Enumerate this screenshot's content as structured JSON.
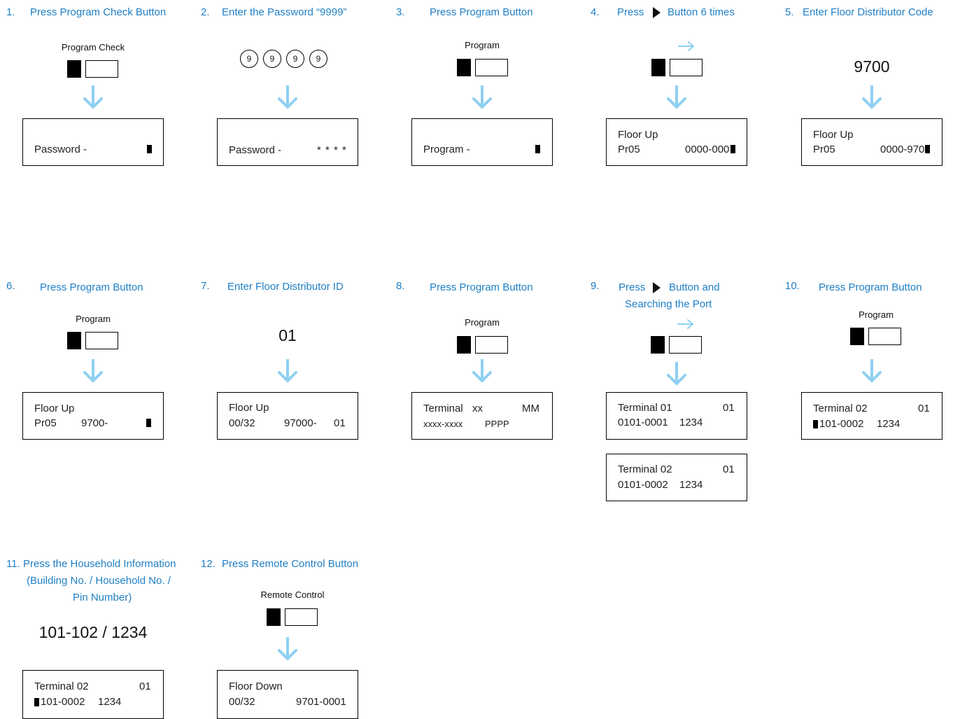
{
  "steps": {
    "s1": {
      "num": "1.",
      "title": "Press Program Check Button",
      "button": "Program Check",
      "lcd": [
        "Password  -",
        ""
      ]
    },
    "s2": {
      "num": "2.",
      "title": "Enter the Password “9999”",
      "digits": [
        "9",
        "9",
        "9",
        "9"
      ],
      "lcd": [
        "Password  -",
        "* * * *"
      ]
    },
    "s3": {
      "num": "3.",
      "title": "Press Program Button",
      "button": "Program",
      "lcd": [
        "Program  -",
        ""
      ]
    },
    "s4": {
      "num": "4.",
      "title_a": "Press",
      "title_b": "Button 6 times",
      "lcd": [
        "Floor Up",
        "Pr05",
        "0000-000"
      ]
    },
    "s5": {
      "num": "5.",
      "title": "Enter Floor Distributor Code",
      "value": "9700",
      "lcd": [
        "Floor Up",
        "Pr05",
        "0000-970"
      ]
    },
    "s6": {
      "num": "6.",
      "title": "Press Program Button",
      "button": "Program",
      "lcd": [
        "Floor Up",
        "Pr05",
        "9700-"
      ]
    },
    "s7": {
      "num": "7.",
      "title": "Enter Floor Distributor ID",
      "value": "01",
      "lcd": [
        "Floor Up",
        "00/32",
        "97000-",
        "01"
      ]
    },
    "s8": {
      "num": "8.",
      "title": "Press Program Button",
      "button": "Program",
      "lcd": [
        "Terminal",
        "xx",
        "MM",
        "xxxx-xxxx",
        "PPPP"
      ]
    },
    "s9": {
      "num": "9.",
      "title_a": "Press",
      "title_b": "Button and",
      "title_c": "Searching the Port",
      "lcd1": [
        "Terminal  01",
        "01",
        "0101-0001",
        "1234"
      ],
      "lcd2": [
        "Terminal  02",
        "01",
        "0101-0002",
        "1234"
      ]
    },
    "s10": {
      "num": "10.",
      "title": "Press Program Button",
      "button": "Program",
      "lcd": [
        "Terminal  02",
        "01",
        "101-0002",
        "1234"
      ]
    },
    "s11": {
      "num": "11.",
      "title_lines": [
        "Press the Household Information",
        "(Building No. / Household No. /",
        "Pin Number)"
      ],
      "value": "101-102 / 1234",
      "lcd": [
        "Terminal  02",
        "01",
        "101-0002",
        "1234"
      ]
    },
    "s12": {
      "num": "12.",
      "title": "Press Remote Control Button",
      "button": "Remote Control",
      "lcd": [
        "Floor Down",
        "00/32",
        "9701-0001"
      ]
    }
  },
  "colors": {
    "accent": "#1f7fc4",
    "arrow": "#8fd0f2",
    "lcd_border": "#000000"
  }
}
